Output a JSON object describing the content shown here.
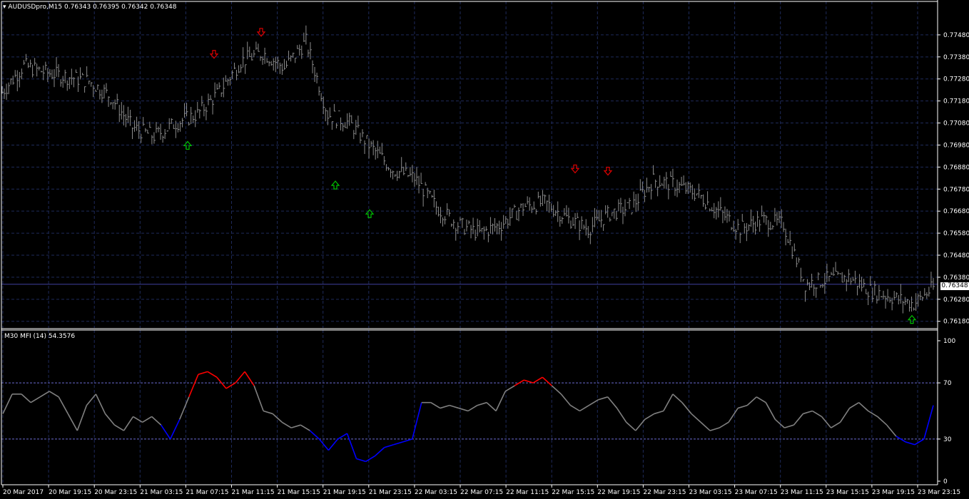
{
  "main_window": {
    "symbol_label": "AUDUSDpro,M15",
    "ohlc": "0.76343 0.76395 0.76342 0.76348",
    "current_price_tag": "0.76348"
  },
  "indicator_window": {
    "title": "M30 MFI (14) 54.3576"
  },
  "colors": {
    "background": "#000000",
    "grid": "#1e2a5a",
    "bars": "#8c8c8c",
    "axis_text": "#ffffff",
    "down_arrow": "#e00000",
    "up_arrow": "#00c000",
    "mfi_line": "#808080",
    "mfi_overbought": "#ff0000",
    "mfi_oversold": "#0000ff",
    "level_line": "#6a6ad0",
    "price_line": "#4040a0"
  },
  "chart_data": [
    {
      "type": "line",
      "title": "AUDUSDpro,M15",
      "y_ticks": [
        "0.77480",
        "0.77380",
        "0.77280",
        "0.77180",
        "0.77080",
        "0.76980",
        "0.76880",
        "0.76780",
        "0.76680",
        "0.76580",
        "0.76480",
        "0.76380",
        "0.76280",
        "0.76180"
      ],
      "ylim": [
        0.7615,
        0.7758
      ],
      "x_ticks": [
        "20 Mar 2017",
        "20 Mar 19:15",
        "20 Mar 23:15",
        "21 Mar 03:15",
        "21 Mar 07:15",
        "21 Mar 11:15",
        "21 Mar 15:15",
        "21 Mar 19:15",
        "21 Mar 23:15",
        "22 Mar 03:15",
        "22 Mar 07:15",
        "22 Mar 11:15",
        "22 Mar 15:15",
        "22 Mar 19:15",
        "22 Mar 23:15",
        "23 Mar 03:15",
        "23 Mar 07:15",
        "23 Mar 11:15",
        "23 Mar 15:15",
        "23 Mar 19:15",
        "23 Mar 23:15"
      ],
      "current_price": 0.76348,
      "series": [
        {
          "x_index": [
            0,
            10,
            20,
            30,
            40,
            50,
            60,
            70,
            80,
            90,
            100,
            110,
            120,
            130,
            140,
            150,
            160,
            170,
            180,
            190,
            200,
            210,
            220,
            230,
            240,
            250,
            260,
            270,
            280,
            290,
            300,
            310,
            320,
            330,
            340,
            350,
            360,
            370,
            380,
            390,
            400,
            410,
            420,
            430
          ],
          "close": [
            0.7722,
            0.7734,
            0.7731,
            0.7729,
            0.7727,
            0.772,
            0.7706,
            0.7702,
            0.7708,
            0.7712,
            0.7722,
            0.7736,
            0.774,
            0.7733,
            0.7745,
            0.7712,
            0.7708,
            0.7697,
            0.7687,
            0.7683,
            0.767,
            0.7662,
            0.7658,
            0.7662,
            0.767,
            0.7672,
            0.7665,
            0.766,
            0.7667,
            0.767,
            0.7682,
            0.768,
            0.7676,
            0.7668,
            0.766,
            0.7664,
            0.7662,
            0.7635,
            0.7637,
            0.7638,
            0.7632,
            0.7629,
            0.7626,
            0.7634
          ]
        }
      ],
      "signals_down": [
        0.7739,
        0.7749,
        0.7687,
        0.7686
      ],
      "signals_up": [
        0.7698,
        0.768,
        0.7667,
        0.7619
      ]
    },
    {
      "type": "line",
      "title": "M30 MFI (14)",
      "y_ticks": [
        "100",
        "70",
        "30",
        "0"
      ],
      "ylim": [
        0,
        100
      ],
      "levels": [
        70,
        30
      ],
      "series": [
        {
          "name": "MFI",
          "values": [
            48,
            62,
            62,
            56,
            60,
            64,
            60,
            48,
            36,
            54,
            62,
            48,
            40,
            36,
            46,
            42,
            46,
            40,
            30,
            44,
            60,
            76,
            78,
            74,
            66,
            70,
            78,
            68,
            50,
            48,
            42,
            38,
            40,
            36,
            30,
            22,
            30,
            34,
            16,
            14,
            18,
            24,
            26,
            28,
            30,
            56,
            56,
            52,
            54,
            52,
            50,
            54,
            56,
            50,
            64,
            68,
            72,
            70,
            74,
            68,
            62,
            54,
            50,
            54,
            58,
            60,
            52,
            42,
            36,
            44,
            48,
            50,
            62,
            56,
            48,
            42,
            36,
            38,
            42,
            52,
            54,
            60,
            56,
            44,
            38,
            40,
            48,
            50,
            46,
            38,
            42,
            52,
            56,
            50,
            46,
            40,
            32,
            28,
            26,
            30,
            54
          ]
        }
      ]
    }
  ]
}
